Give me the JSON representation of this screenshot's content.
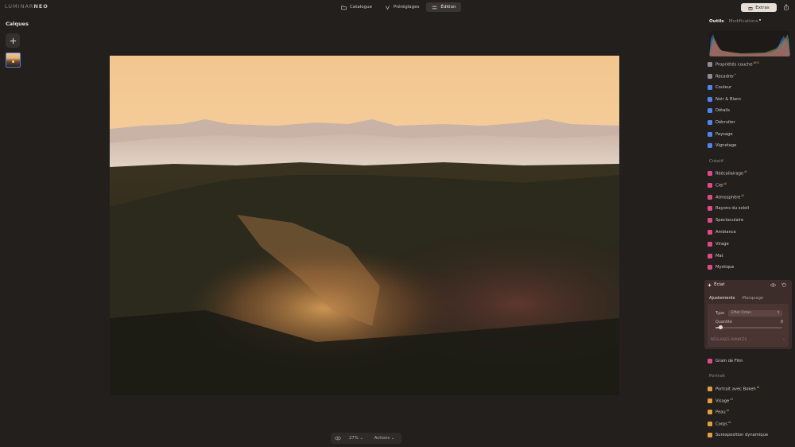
{
  "app": {
    "logo_dim": "LUMINAR",
    "logo_bold": "NEO"
  },
  "top_tabs": [
    {
      "label": "Catalogue",
      "icon": "folder-icon"
    },
    {
      "label": "Préréglages",
      "icon": "presets-icon"
    },
    {
      "label": "Édition",
      "icon": "sliders-icon",
      "active": true
    }
  ],
  "extras_label": "Extras",
  "left_panel": {
    "title": "Calques"
  },
  "bottom_bar": {
    "zoom": "27% ⌄",
    "actions": "Actions ⌄"
  },
  "right_panel": {
    "tab_tools": "Outils",
    "tab_edits": "Modifications",
    "tools": [
      {
        "label": "Propriétés couche",
        "sup": "NEO",
        "color": "#8a8f96"
      },
      {
        "label": "Recadrer",
        "sup": "*",
        "color": "#8a8f96"
      },
      {
        "label": "Couleur",
        "sup": "",
        "color": "#4f86e8"
      },
      {
        "label": "Noir & Blanc",
        "sup": "",
        "color": "#4f86e8"
      },
      {
        "label": "Détails",
        "sup": "",
        "color": "#4f86e8"
      },
      {
        "label": "Débruiter",
        "sup": "",
        "color": "#4f86e8"
      },
      {
        "label": "Paysage",
        "sup": "",
        "color": "#4f86e8"
      },
      {
        "label": "Vignetage",
        "sup": "",
        "color": "#4f86e8"
      }
    ],
    "creative_title": "Créatif",
    "creative": [
      {
        "label": "Réécailairage",
        "sup": "AI",
        "color": "#e04a8a"
      },
      {
        "label": "Ciel",
        "sup": "AI",
        "color": "#e04a8a"
      },
      {
        "label": "Atmosphère",
        "sup": "AI",
        "color": "#e04a8a"
      },
      {
        "label": "Rayons du soleil",
        "sup": "",
        "color": "#e04a8a"
      },
      {
        "label": "Spectaculaire",
        "sup": "",
        "color": "#e04a8a"
      },
      {
        "label": "Ambiance",
        "sup": "",
        "color": "#e04a8a"
      },
      {
        "label": "Virage",
        "sup": "",
        "color": "#e04a8a"
      },
      {
        "label": "Mat",
        "sup": "",
        "color": "#e04a8a"
      },
      {
        "label": "Mystique",
        "sup": "",
        "color": "#e04a8a"
      }
    ],
    "eclat": {
      "title": "Éclat",
      "subtab_adjust": "Ajustements",
      "subtab_mask": "Masquage",
      "type_label": "Type",
      "type_value": "Effet Orton",
      "amount_label": "Quantité",
      "amount_value": "8",
      "amount_fraction": 0.08,
      "advanced": "RÉGLAGES AVANCÉS"
    },
    "after_eclat": [
      {
        "label": "Grain de Film",
        "sup": "",
        "color": "#e04a8a"
      }
    ],
    "portrait_title": "Portrait",
    "portrait": [
      {
        "label": "Portrait avec Bokeh",
        "sup": "AI",
        "color": "#e0a040"
      },
      {
        "label": "Visage",
        "sup": "AI",
        "color": "#e0a040"
      },
      {
        "label": "Peau",
        "sup": "AI",
        "color": "#e0a040"
      },
      {
        "label": "Corps",
        "sup": "AI",
        "color": "#e0a040"
      },
      {
        "label": "Surexposition dynamique",
        "sup": "",
        "color": "#e0a040"
      }
    ]
  }
}
